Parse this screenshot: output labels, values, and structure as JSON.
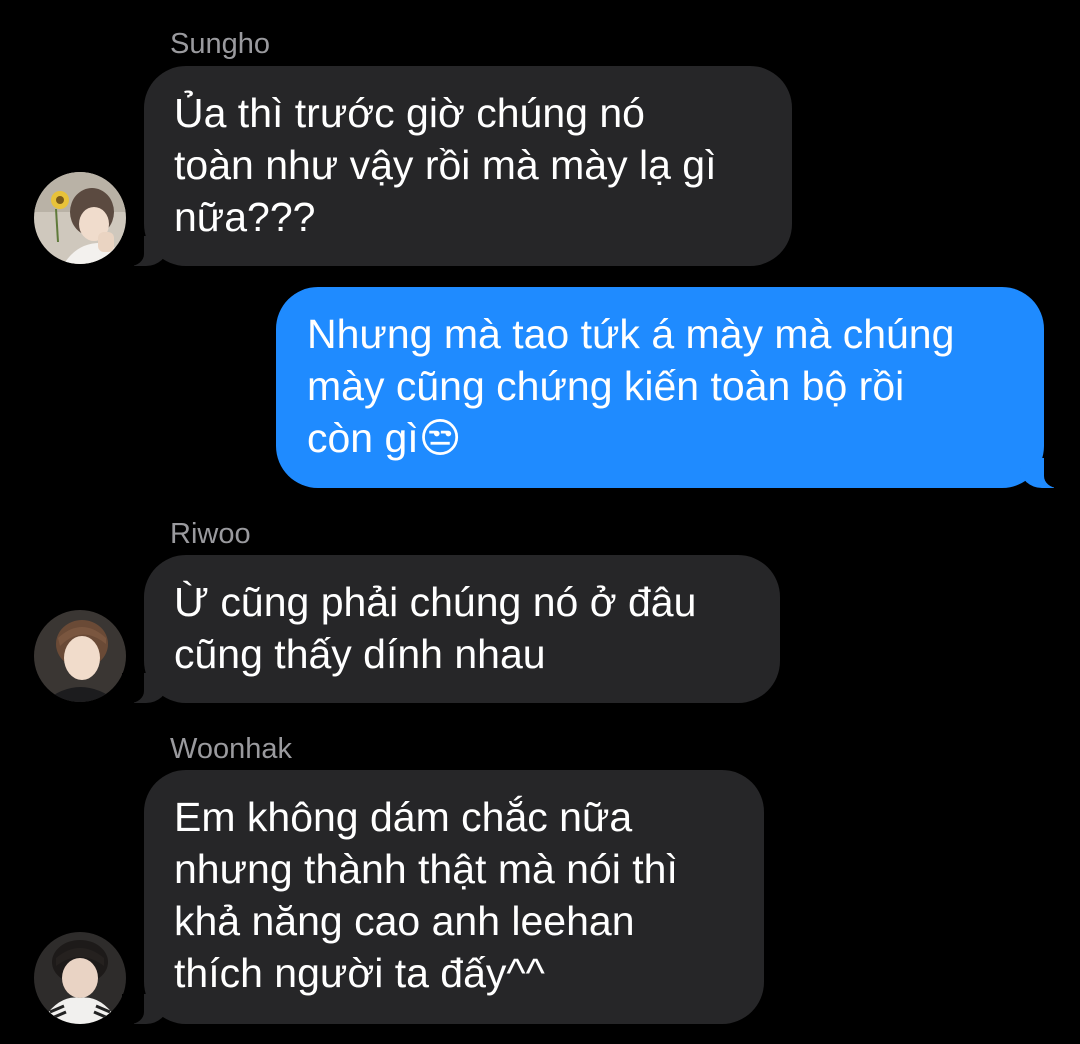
{
  "messages": [
    {
      "sender": "Sungho",
      "direction": "incoming",
      "avatar": "avatar-sungho",
      "text": "Ủa thì trước giờ chúng nó\ntoàn như vậy rồi mà mày lạ gì\nnữa???"
    },
    {
      "direction": "outgoing",
      "text": "Nhưng mà tao tứk á mày mà chúng\nmày cũng chứng kiến toàn bộ rồi\ncòn gì😒"
    },
    {
      "sender": "Riwoo",
      "direction": "incoming",
      "avatar": "avatar-riwoo",
      "text": "Ừ cũng phải chúng nó ở đâu\ncũng thấy dính nhau"
    },
    {
      "sender": "Woonhak",
      "direction": "incoming",
      "avatar": "avatar-woonhak",
      "text": "Em không dám chắc nữa\nnhưng thành thật mà nói thì\nkhả năng cao anh leehan\nthích người ta đấy^^"
    }
  ],
  "colors": {
    "background": "#000000",
    "incoming_bubble": "#262628",
    "outgoing_bubble": "#1f8bff",
    "sender_name": "#9a9a9e"
  }
}
